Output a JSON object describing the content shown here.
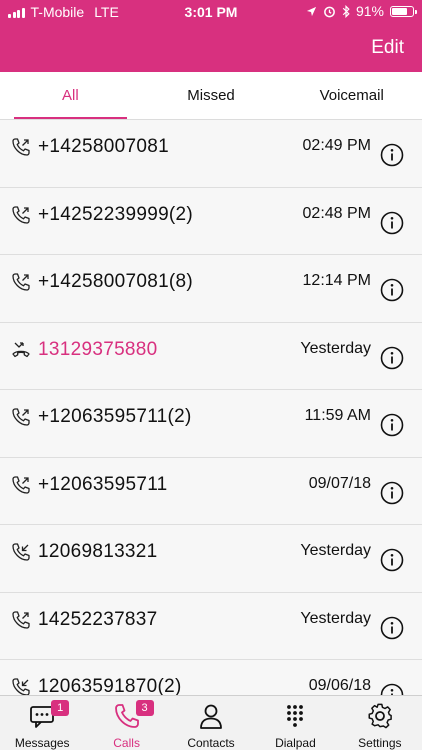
{
  "status_bar": {
    "carrier": "T-Mobile",
    "network": "LTE",
    "time": "3:01 PM",
    "battery": "91%",
    "battery_level": 0.91
  },
  "header": {
    "edit_label": "Edit",
    "color": "#d8307f"
  },
  "tabs": [
    {
      "label": "All",
      "active": true
    },
    {
      "label": "Missed",
      "active": false
    },
    {
      "label": "Voicemail",
      "active": false
    }
  ],
  "calls": [
    {
      "number": "+14258007081",
      "time": "02:49 PM",
      "type": "outgoing"
    },
    {
      "number": "+14252239999(2)",
      "time": "02:48 PM",
      "type": "outgoing"
    },
    {
      "number": "+14258007081(8)",
      "time": "12:14 PM",
      "type": "outgoing"
    },
    {
      "number": "13129375880",
      "time": "Yesterday",
      "type": "missed"
    },
    {
      "number": "+12063595711(2)",
      "time": "11:59 AM",
      "type": "outgoing"
    },
    {
      "number": "+12063595711",
      "time": "09/07/18",
      "type": "outgoing"
    },
    {
      "number": "12069813321",
      "time": "Yesterday",
      "type": "incoming"
    },
    {
      "number": "14252237837",
      "time": "Yesterday",
      "type": "outgoing"
    },
    {
      "number": "12063591870(2)",
      "time": "09/06/18",
      "type": "incoming"
    }
  ],
  "tab_bar": [
    {
      "label": "Messages",
      "icon": "messages-icon",
      "badge": "1",
      "active": false
    },
    {
      "label": "Calls",
      "icon": "calls-icon",
      "badge": "3",
      "active": true
    },
    {
      "label": "Contacts",
      "icon": "contacts-icon",
      "badge": "",
      "active": false
    },
    {
      "label": "Dialpad",
      "icon": "dialpad-icon",
      "badge": "",
      "active": false
    },
    {
      "label": "Settings",
      "icon": "settings-icon",
      "badge": "",
      "active": false
    }
  ]
}
